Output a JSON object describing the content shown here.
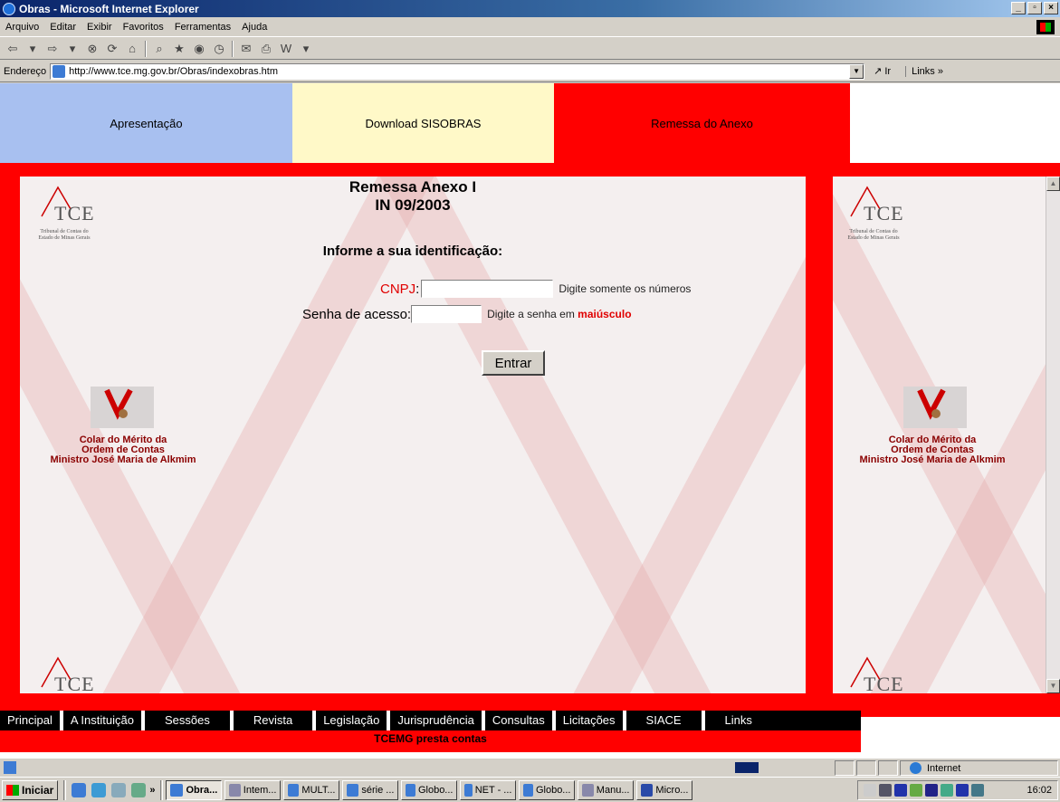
{
  "window": {
    "title": "Obras - Microsoft Internet Explorer"
  },
  "menu": [
    "Arquivo",
    "Editar",
    "Exibir",
    "Favoritos",
    "Ferramentas",
    "Ajuda"
  ],
  "address": {
    "label": "Endereço",
    "url": "http://www.tce.mg.gov.br/Obras/indexobras.htm",
    "go": "Ir",
    "links": "Links »"
  },
  "topnav": {
    "apresentacao": "Apresentação",
    "download": "Download SISOBRAS",
    "remessa": "Remessa do Anexo"
  },
  "logo": {
    "text": "TCE",
    "tag": "mg",
    "subtitle": "Tribunal de Contas do Estado de Minas Gerais"
  },
  "medal": {
    "caption_line1": "Colar do Mérito da",
    "caption_line2": "Ordem de Contas",
    "caption_line3": "Ministro José Maria de Alkmim"
  },
  "form": {
    "title_line1": "Remessa Anexo I",
    "title_line2": "IN 09/2003",
    "prompt": "Informe a sua identificação:",
    "cnpj_label": "CNPJ",
    "cnpj_value": "",
    "cnpj_hint": "Digite somente os números",
    "senha_label": "Senha de acesso:",
    "senha_value": "",
    "senha_hint_prefix": "Digite a senha em",
    "senha_hint_bold": "maiúsculo",
    "submit": "Entrar"
  },
  "bottomnav": [
    "Principal",
    "A Instituição",
    "Sessões",
    "Revista",
    "Legislação",
    "Jurisprudência",
    "Consultas",
    "Licitações",
    "SIACE",
    "Links"
  ],
  "footer": "TCEMG presta contas",
  "status": {
    "zone": "Internet"
  },
  "taskbar": {
    "start": "Iniciar",
    "tasks": [
      "Obra...",
      "Intem...",
      "MULT...",
      "série ...",
      "Globo...",
      "NET - ...",
      "Globo...",
      "Manu...",
      "Micro..."
    ],
    "clock": "16:02"
  },
  "colors": {
    "red": "#ff0000",
    "blue_tab": "#a8c0f0",
    "yellow_tab": "#fff9c8",
    "title_blue": "#0a246a"
  }
}
